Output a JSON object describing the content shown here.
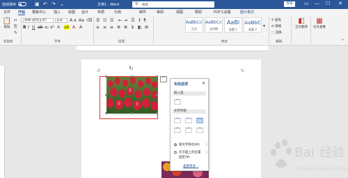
{
  "titlebar": {
    "autosave": "自动保存",
    "doc_title": "文档1 - Word",
    "search_placeholder": "搜索",
    "login": "登录"
  },
  "tabs": [
    "文件",
    "开始",
    "模板中心",
    "插入",
    "绘图",
    "设计",
    "布局",
    "引用",
    "邮件",
    "审阅",
    "视图",
    "帮助",
    "PDF工具集",
    "图片格式"
  ],
  "ribbon": {
    "clipboard": {
      "paste": "粘贴",
      "label": "剪贴板"
    },
    "font": {
      "name": "等线 (西文正文)",
      "size": "五号",
      "label": "字体"
    },
    "paragraph": {
      "label": "段落"
    },
    "styles": {
      "label": "样式",
      "cards": [
        {
          "sample": "AaBbCcDc",
          "name": "正文"
        },
        {
          "sample": "AaBbCcDc",
          "name": "无间隔"
        },
        {
          "sample": "AaBl",
          "name": "标题 1"
        },
        {
          "sample": "AaBbC",
          "name": "标题 2"
        }
      ]
    },
    "editing": {
      "find": "查找",
      "replace": "替换",
      "select": "选择",
      "label": "编辑"
    },
    "save": {
      "label": "全文翻译"
    },
    "tools": {
      "label": "论文查重"
    }
  },
  "popup": {
    "title": "布局选项",
    "inline_section": "嵌入型",
    "wrap_section": "文字环绕",
    "option_move": "随文字移动(M)",
    "option_fix_line1": "在页面上的位置",
    "option_fix_line2": "固定(N)",
    "see_more": "查看更多..."
  },
  "colors": {
    "accent": "#2b579a",
    "selection_border": "#e0302a"
  }
}
